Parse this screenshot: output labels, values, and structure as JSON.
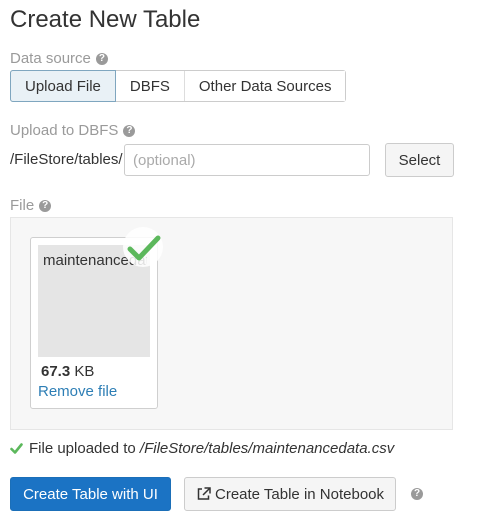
{
  "page": {
    "title": "Create New Table"
  },
  "data_source": {
    "label": "Data source",
    "tabs": [
      {
        "label": "Upload File",
        "active": true
      },
      {
        "label": "DBFS",
        "active": false
      },
      {
        "label": "Other Data Sources",
        "active": false
      }
    ]
  },
  "upload_dbfs": {
    "label": "Upload to DBFS",
    "path_prefix": "/FileStore/tables/",
    "input_value": "",
    "input_placeholder": "(optional)",
    "select_label": "Select"
  },
  "file": {
    "label": "File",
    "name": "maintenancedata.csv",
    "size_value": "67.3",
    "size_unit": "KB",
    "remove_label": "Remove file"
  },
  "status": {
    "prefix": "File uploaded to",
    "path": "/FileStore/tables/maintenancedata.csv"
  },
  "actions": {
    "create_ui_label": "Create Table with UI",
    "create_notebook_label": "Create Table in Notebook"
  },
  "colors": {
    "primary": "#1b73c4",
    "success": "#5cb85c",
    "link": "#2d7eb5",
    "muted": "#9a9a9a"
  }
}
